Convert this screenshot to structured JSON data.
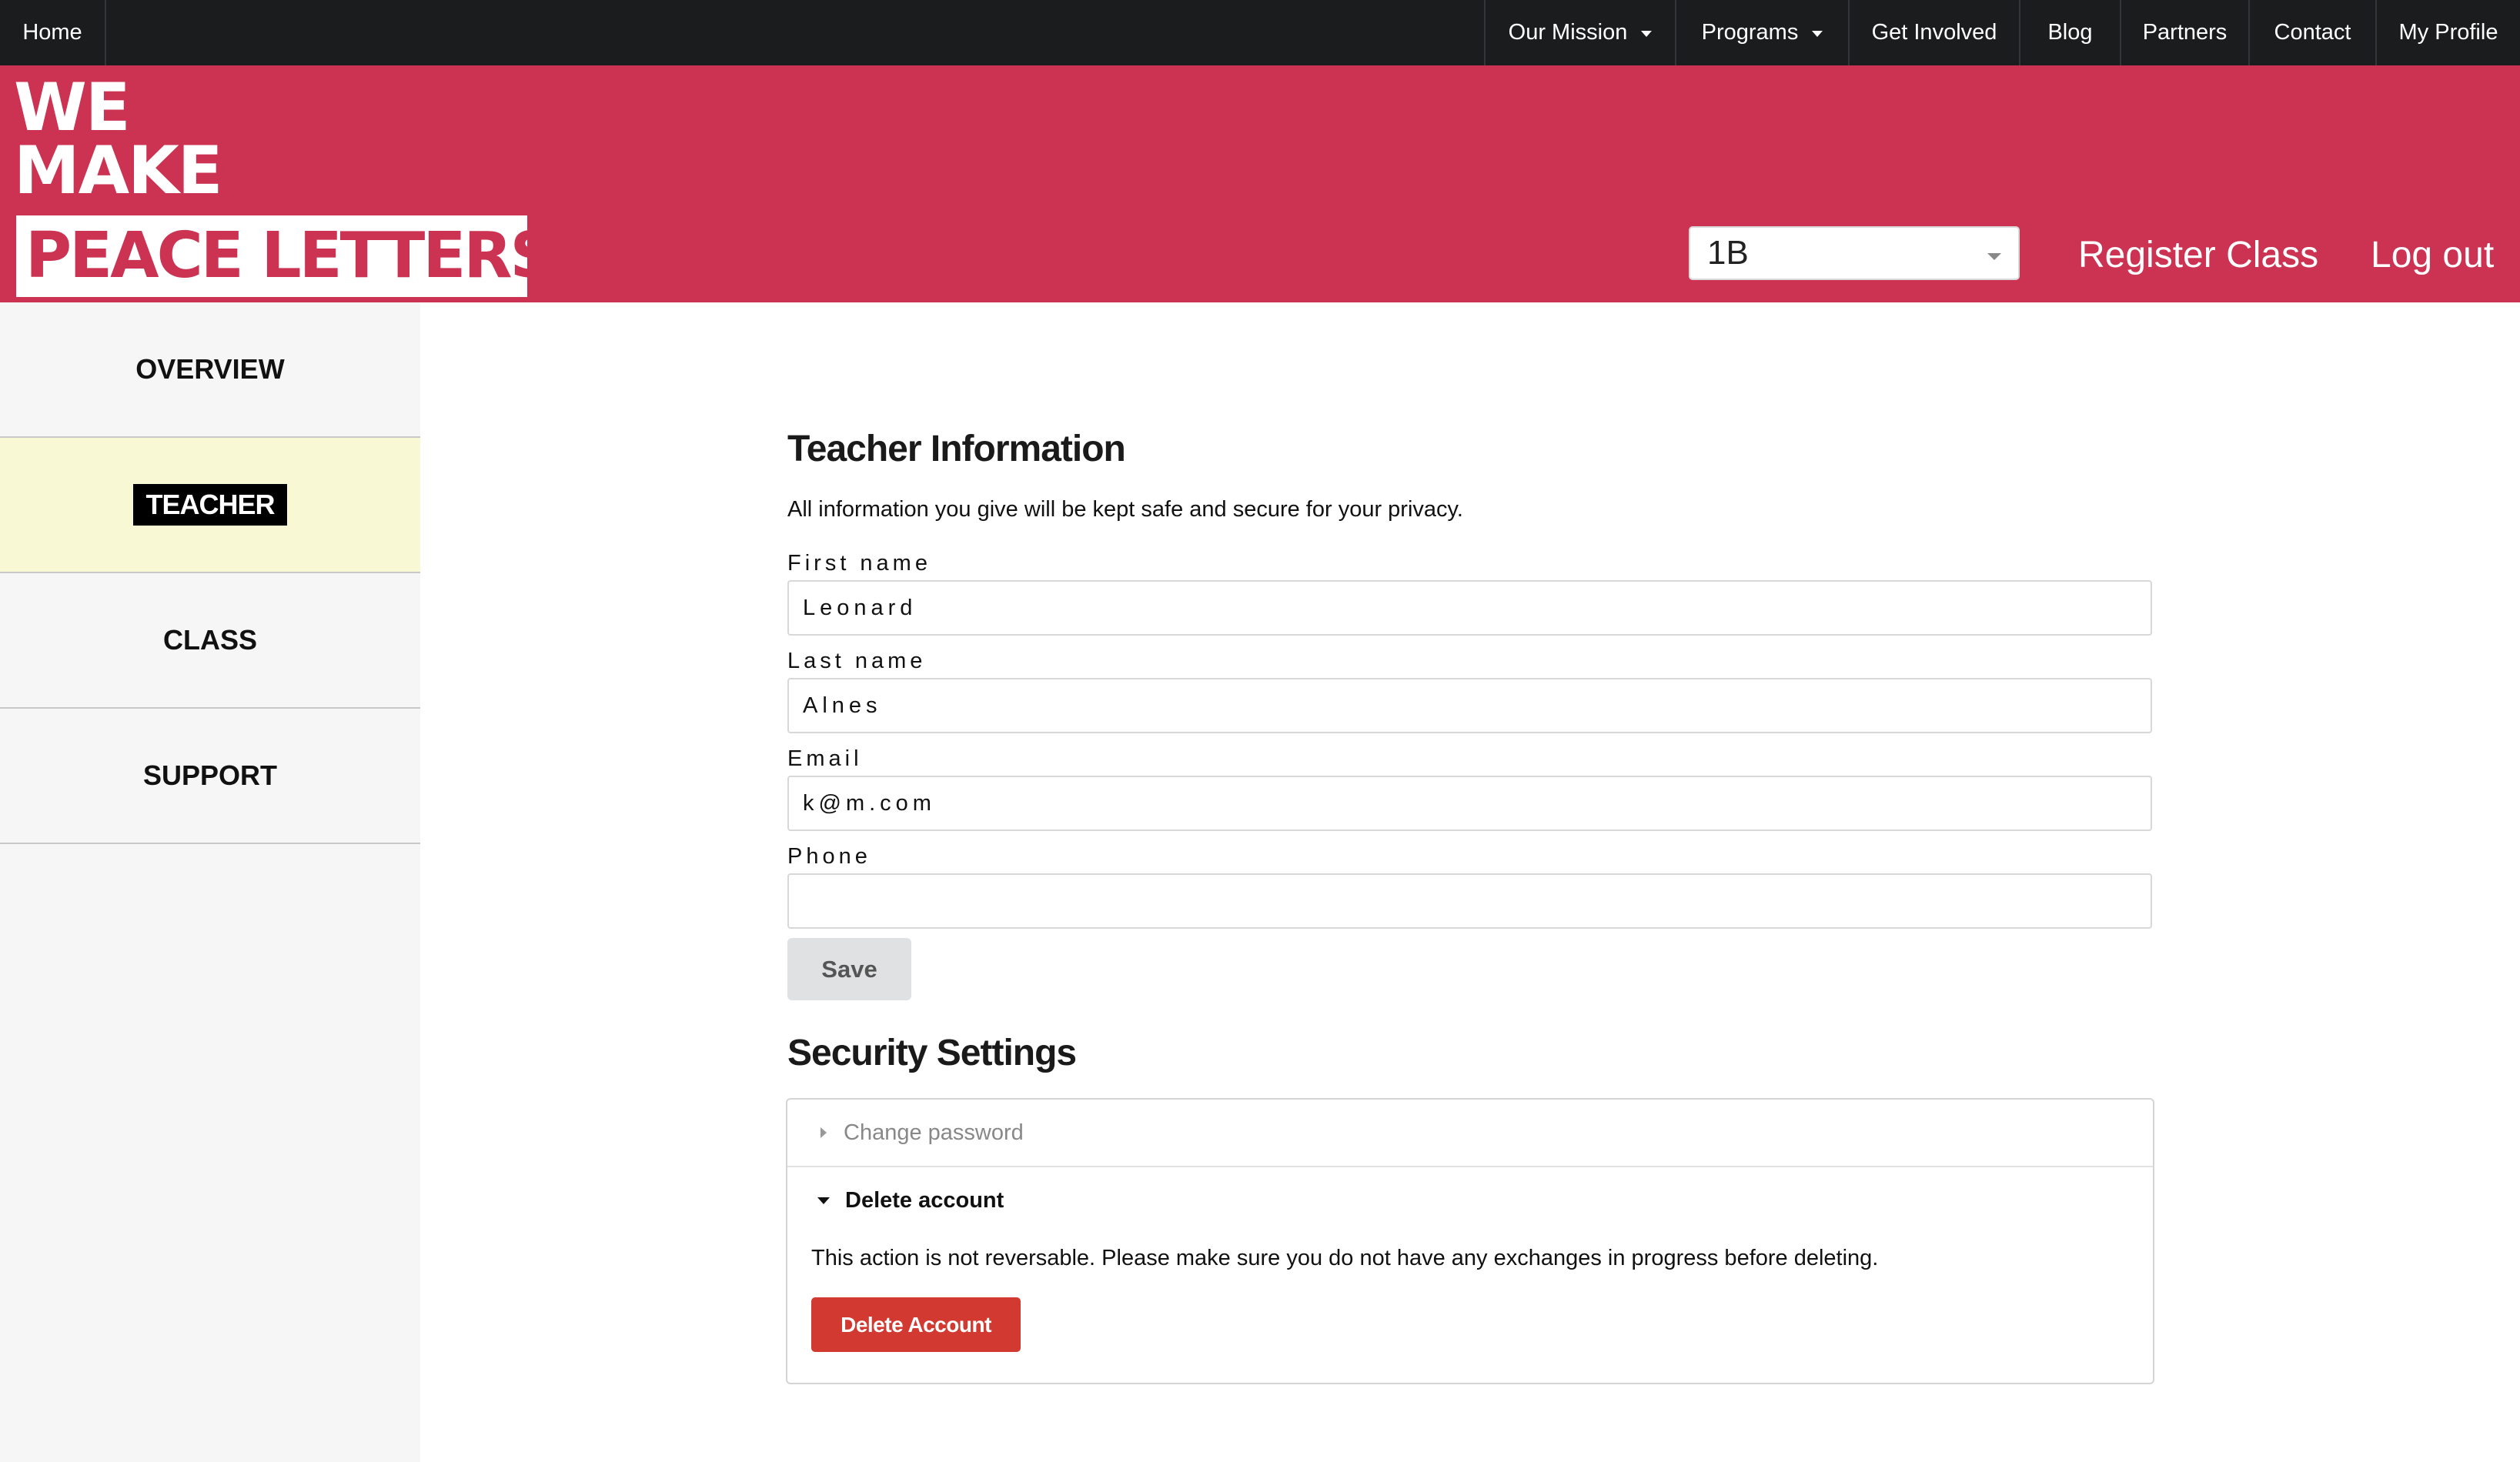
{
  "topnav": {
    "home": "Home",
    "items": [
      {
        "label": "Our Mission",
        "dropdown": true
      },
      {
        "label": "Programs",
        "dropdown": true
      },
      {
        "label": "Get Involved",
        "dropdown": false
      },
      {
        "label": "Blog",
        "dropdown": false
      },
      {
        "label": "Partners",
        "dropdown": false
      },
      {
        "label": "Contact",
        "dropdown": false
      },
      {
        "label": "My Profile",
        "dropdown": false
      }
    ]
  },
  "header": {
    "logo_line1": "WE",
    "logo_line2": "MAKE",
    "logo_line3": "PEACE LETTERS",
    "class_select_value": "1B",
    "register_class": "Register Class",
    "log_out": "Log out"
  },
  "sidebar": {
    "items": [
      {
        "label": "OVERVIEW"
      },
      {
        "label": "TEACHER"
      },
      {
        "label": "CLASS"
      },
      {
        "label": "SUPPORT"
      }
    ],
    "active": "TEACHER"
  },
  "teacher_info": {
    "title": "Teacher Information",
    "privacy_note": "All information you give will be kept safe and secure for your privacy.",
    "fields": {
      "first_name": {
        "label": "First name",
        "value": "Leonard"
      },
      "last_name": {
        "label": "Last name",
        "value": "Alnes"
      },
      "email": {
        "label": "Email",
        "value": "k@m.com"
      },
      "phone": {
        "label": "Phone",
        "value": ""
      }
    },
    "save_label": "Save"
  },
  "security": {
    "title": "Security Settings",
    "change_password": "Change password",
    "delete_account": "Delete account",
    "warning": "This action is not reversable. Please make sure you do not have any exchanges in progress before deleting.",
    "delete_button": "Delete Account"
  },
  "colors": {
    "brand_red": "#cc3352",
    "nav_bg": "#1b1c1e",
    "active_sidebar": "#f8f8d4",
    "danger": "#d23a31"
  }
}
